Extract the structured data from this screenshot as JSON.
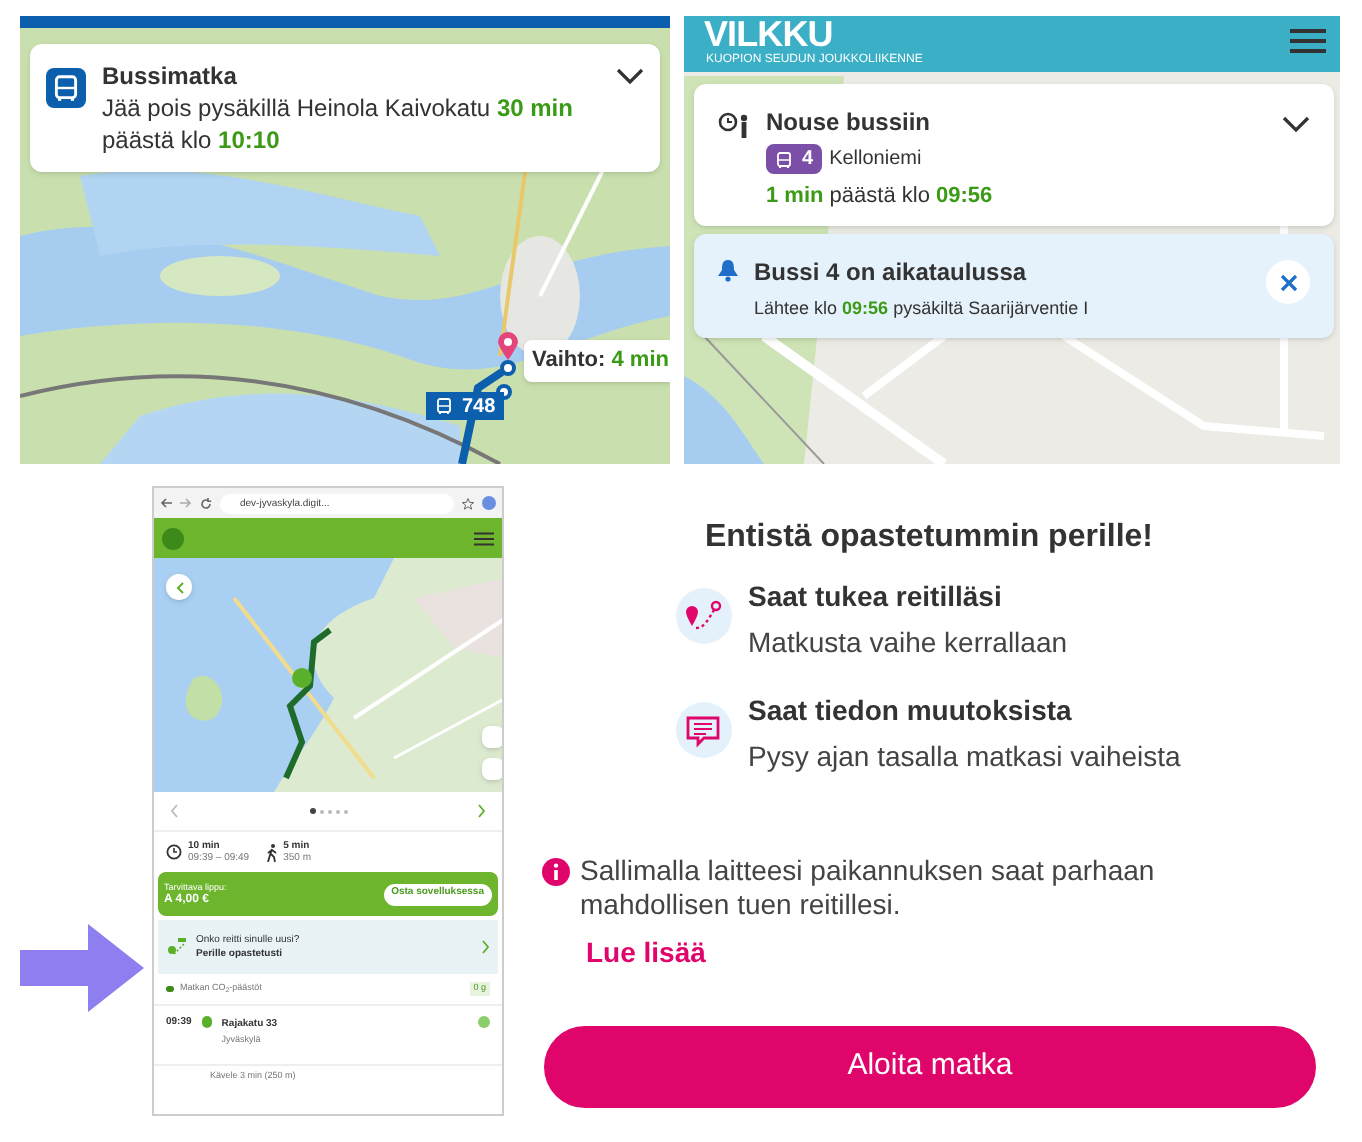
{
  "bus_trip_card": {
    "title": "Bussimatka",
    "text": "Jää pois pysäkillä Heinola Kaivokatu **30 min** päästä klo **10:10**"
  },
  "top_map": {
    "transfer_callout": "Vaihto: **4 min**",
    "route_badge": "748"
  },
  "vilkku": {
    "logo": "VILKKU",
    "tagline": "KUOPION SEUDUN JOUKKOLIIKENNE",
    "boarding_card": {
      "title": "Nouse bussiin",
      "line": "4",
      "destination": "Kelloniemi",
      "time": "**1 min** päästä klo **09:56**"
    },
    "alert": {
      "title": "Bussi 4 on aikataulussa",
      "text": "Lähtee klo **09:56** pysäkiltä Saarijärventie I"
    }
  },
  "phone": {
    "url": "dev-jyvaskyla.digit...",
    "pager": [
      {
        "selected": true
      },
      {
        "selected": false
      },
      {
        "selected": false
      },
      {
        "selected": false
      },
      {
        "selected": false
      }
    ],
    "legs": [
      {
        "kind": "time",
        "primary": "10 min",
        "secondary": "09:39 – 09:49"
      },
      {
        "kind": "walk",
        "primary": "5 min",
        "secondary": "350 m"
      }
    ],
    "ticket": {
      "label": "Tarvittava lippu:",
      "price": "A 4,00 €",
      "button": "Osta sovelluksessa"
    },
    "guide_card": {
      "question": "Onko reitti sinulle uusi?",
      "action": "Perille opastetusti"
    },
    "emissions": {
      "label": "Matkan CO$_{2}$-päästöt",
      "value": "0 g"
    },
    "stop": {
      "time": "09:39",
      "name": "Rajakatu 33",
      "area": "Jyväskylä"
    },
    "walk_step": "Kävele 3 min (250 m)"
  },
  "intro": {
    "title": "Entistä opastetummin perille!",
    "features": [
      {
        "kind": "route",
        "title": "Saat tukea reitilläsi",
        "text": "Matkusta vaihe kerrallaan"
      },
      {
        "kind": "message",
        "title": "Saat tiedon muutoksista",
        "text": "Pysy ajan tasalla matkasi vaiheista"
      }
    ],
    "info": "Sallimalla laitteesi paikannuksen saat parhaan mahdollisen tuen reitillesi.",
    "link": "Lue lisää",
    "button": "Aloita matka"
  }
}
